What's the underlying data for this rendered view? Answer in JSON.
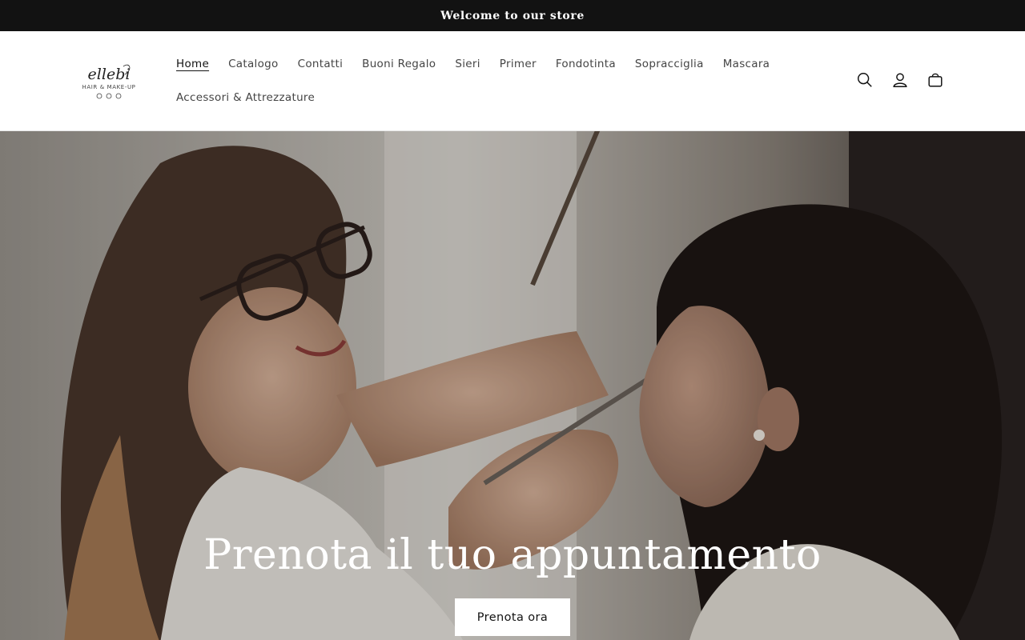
{
  "announcement": {
    "text": "Welcome to our store"
  },
  "header": {
    "logo": {
      "script_text": "ellebi",
      "tagline": "HAIR & MAKE-UP"
    },
    "nav": [
      {
        "label": "Home",
        "active": true
      },
      {
        "label": "Catalogo"
      },
      {
        "label": "Contatti"
      },
      {
        "label": "Buoni Regalo"
      },
      {
        "label": "Sieri"
      },
      {
        "label": "Primer"
      },
      {
        "label": "Fondotinta"
      },
      {
        "label": "Sopracciglia"
      },
      {
        "label": "Mascara"
      },
      {
        "label": "Accessori & Attrezzature"
      }
    ],
    "icons": [
      "search-icon",
      "account-icon",
      "cart-icon"
    ]
  },
  "hero": {
    "title": "Prenota il tuo appuntamento",
    "button_label": "Prenota ora"
  }
}
